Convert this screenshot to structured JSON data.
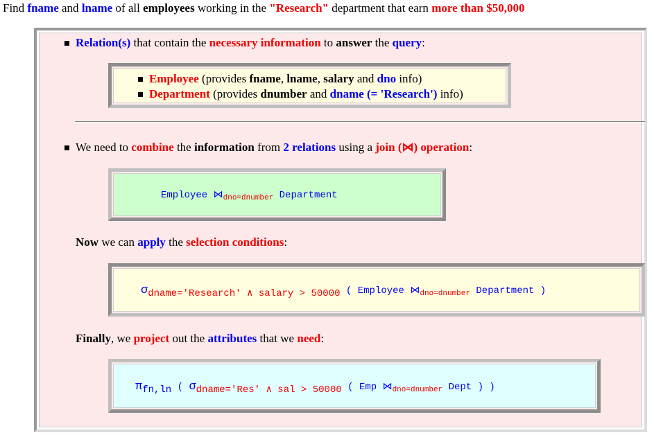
{
  "title": {
    "t1": "Find ",
    "fname": "fname",
    "t2": " and ",
    "lname": "lname",
    "t3": " of all ",
    "employees": "employees",
    "t4": " working in the ",
    "research": "\"Research\"",
    "t5": " department that earn ",
    "more": "more than $50,000"
  },
  "bullet1": {
    "relations": "Relation(s)",
    "t1": " that contain the ",
    "necessary": "necessary information",
    "t2": " to ",
    "answer": "answer",
    "t3": " the ",
    "query": "query",
    "t4": ":"
  },
  "relbox": {
    "emp": "Employee",
    "emp_t1": " (provides ",
    "emp_fname": "fname",
    "emp_t2": ", ",
    "emp_lname": "lname",
    "emp_t3": ", ",
    "emp_salary": "salary",
    "emp_t4": " and ",
    "emp_dno": "dno",
    "emp_t5": " info)",
    "dept": "Department",
    "dept_t1": " (provides ",
    "dept_dnumber": "dnumber",
    "dept_t2": " and ",
    "dept_dname": "dname (= 'Research')",
    "dept_t3": " info)"
  },
  "bullet2": {
    "t1": "We need to ",
    "combine": "combine",
    "t2": " the ",
    "information": "information",
    "t3": " from ",
    "two": "2 relations",
    "t4": " using a ",
    "join": "join (⋈) operation",
    "t5": ":"
  },
  "joinbox": {
    "left": "Employee ",
    "join": "⋈",
    "sub": "dno=dnumber",
    "right": " Department"
  },
  "now": {
    "now": "Now",
    "t1": " we can ",
    "apply": "apply",
    "t2": " the ",
    "selection": "selection conditions",
    "t3": ":"
  },
  "selbox": {
    "sigma": "σ",
    "sub1": "dname='Research'",
    "and": " ∧ ",
    "cond": "salary",
    "gt": " > ",
    "num": "50000",
    "open": "  ( ",
    "left": "Employee ",
    "join": "⋈",
    "sub2": "dno=dnumber",
    "right": " Department",
    "close": " )"
  },
  "finally": {
    "finally": "Finally",
    "t1": ", we ",
    "project": "project",
    "t2": " out the ",
    "attributes": "attributes",
    "t3": " that we ",
    "need": "need",
    "t4": ":"
  },
  "projbox": {
    "pi": "π",
    "pisub": "fn,ln",
    "open1": " ( ",
    "sigma": "σ",
    "sub1": "dname='Res'",
    "and": " ∧ ",
    "cond": "sal",
    "gt": " > ",
    "num": "50000",
    "open2": "  ( ",
    "left": "Emp ",
    "join": "⋈",
    "sub2": "dno=dnumber",
    "right": " Dept",
    "close1": " )",
    "close2": "  )"
  }
}
